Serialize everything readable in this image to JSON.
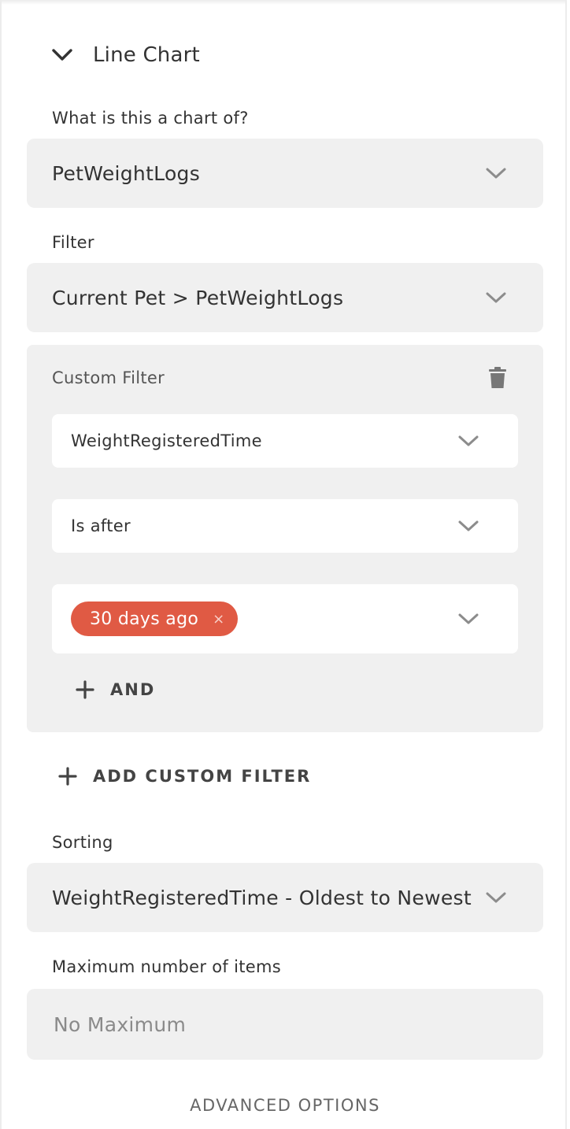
{
  "section": {
    "title": "Line Chart"
  },
  "chart_of": {
    "label": "What is this a chart of?",
    "value": "PetWeightLogs"
  },
  "filter": {
    "label": "Filter",
    "value": "Current Pet > PetWeightLogs"
  },
  "custom_filter": {
    "title": "Custom Filter",
    "field": "WeightRegisteredTime",
    "operator": "Is after",
    "value_tag": "30 days ago",
    "remove_symbol": "×",
    "and_label": "AND"
  },
  "add_custom_filter_label": "ADD CUSTOM FILTER",
  "sorting": {
    "label": "Sorting",
    "value": "WeightRegisteredTime - Oldest to Newest"
  },
  "max_items": {
    "label": "Maximum number of items",
    "placeholder": "No Maximum"
  },
  "advanced_options_label": "ADVANCED OPTIONS",
  "colors": {
    "accent_tag": "#e05a44",
    "field_bg": "#f0f0f0"
  },
  "icons": [
    "chevron-down-icon",
    "trash-icon",
    "plus-icon",
    "close-icon"
  ]
}
